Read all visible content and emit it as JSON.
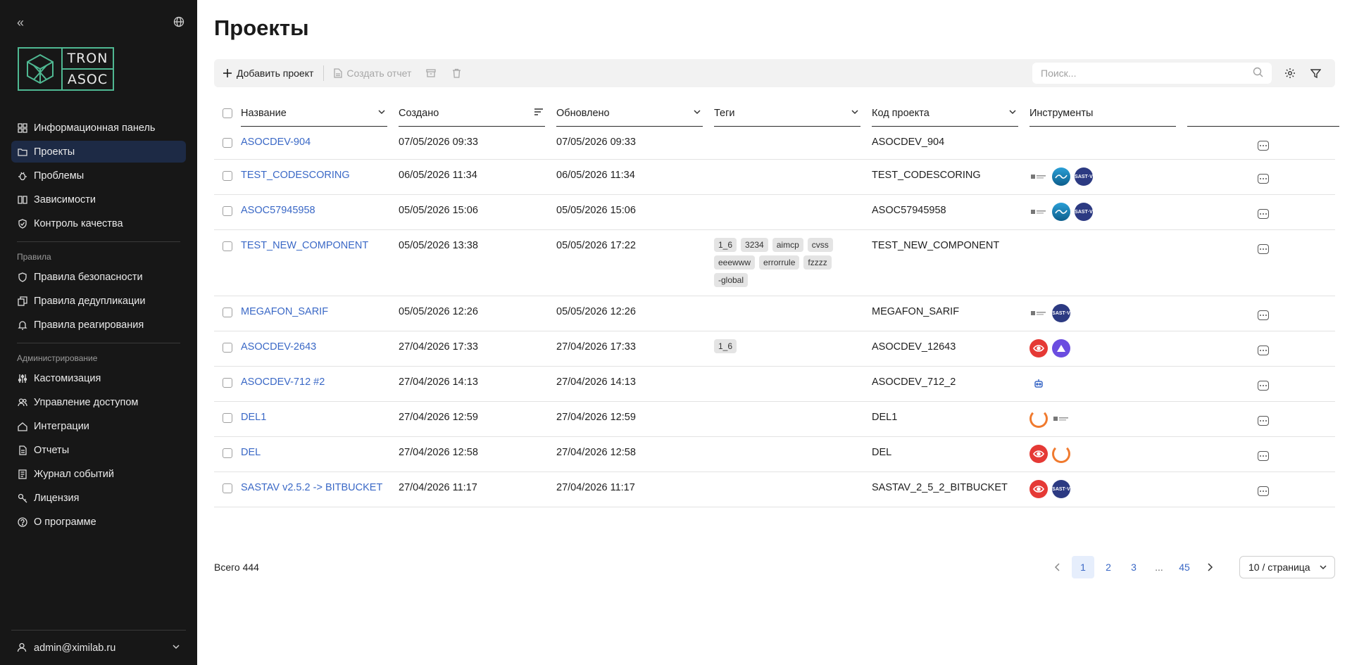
{
  "sidebar": {
    "logo": {
      "line1": "TRON",
      "line2": "ASOC"
    },
    "nav": [
      {
        "label": "Информационная панель",
        "icon": "dashboard-icon",
        "active": false
      },
      {
        "label": "Проекты",
        "icon": "folder-icon",
        "active": true
      },
      {
        "label": "Проблемы",
        "icon": "bug-icon",
        "active": false
      },
      {
        "label": "Зависимости",
        "icon": "book-icon",
        "active": false
      },
      {
        "label": "Контроль качества",
        "icon": "shield-check-icon",
        "active": false
      }
    ],
    "section_rules": "Правила",
    "rules": [
      {
        "label": "Правила безопасности",
        "icon": "shield-icon"
      },
      {
        "label": "Правила дедупликации",
        "icon": "copy-icon"
      },
      {
        "label": "Правила реагирования",
        "icon": "bell-icon"
      }
    ],
    "section_admin": "Администрирование",
    "admin": [
      {
        "label": "Кастомизация",
        "icon": "sliders-icon"
      },
      {
        "label": "Управление доступом",
        "icon": "users-icon"
      },
      {
        "label": "Интеграции",
        "icon": "cloud-icon"
      },
      {
        "label": "Отчеты",
        "icon": "file-icon"
      },
      {
        "label": "Журнал событий",
        "icon": "journal-icon"
      },
      {
        "label": "Лицензия",
        "icon": "key-icon"
      },
      {
        "label": "О программе",
        "icon": "help-icon"
      }
    ],
    "user": "admin@ximilab.ru"
  },
  "page": {
    "title": "Проекты"
  },
  "toolbar": {
    "add_label": "Добавить проект",
    "report_label": "Создать отчет",
    "search_placeholder": "Поиск..."
  },
  "table": {
    "headers": {
      "name": "Название",
      "created": "Создано",
      "updated": "Обновлено",
      "tags": "Теги",
      "code": "Код проекта",
      "tools": "Инструменты"
    },
    "rows": [
      {
        "name": "ASOCDEV-904",
        "created": "07/05/2026 09:33",
        "updated": "07/05/2026 09:33",
        "tags": [],
        "code": "ASOCDEV_904",
        "tools": []
      },
      {
        "name": "TEST_CODESCORING",
        "created": "06/05/2026 11:34",
        "updated": "06/05/2026 11:34",
        "tags": [],
        "code": "TEST_CODESCORING",
        "tools": [
          "logo",
          "wave",
          "sast"
        ]
      },
      {
        "name": "ASOC57945958",
        "created": "05/05/2026 15:06",
        "updated": "05/05/2026 15:06",
        "tags": [],
        "code": "ASOC57945958",
        "tools": [
          "logo",
          "wave",
          "sast"
        ]
      },
      {
        "name": "TEST_NEW_COMPONENT",
        "created": "05/05/2026 13:38",
        "updated": "05/05/2026 17:22",
        "tags": [
          "1_6",
          "3234",
          "aimcp",
          "cvss",
          "eeewww",
          "errorrule",
          "fzzzz",
          "-global"
        ],
        "code": "TEST_NEW_COMPONENT",
        "tools": []
      },
      {
        "name": "MEGAFON_SARIF",
        "created": "05/05/2026 12:26",
        "updated": "05/05/2026 12:26",
        "tags": [],
        "code": "MEGAFON_SARIF",
        "tools": [
          "logo",
          "sast"
        ]
      },
      {
        "name": "ASOCDEV-2643",
        "created": "27/04/2026 17:33",
        "updated": "27/04/2026 17:33",
        "tags": [
          "1_6"
        ],
        "code": "ASOCDEV_12643",
        "tools": [
          "eye",
          "purple"
        ]
      },
      {
        "name": "ASOCDEV-712 #2",
        "created": "27/04/2026 14:13",
        "updated": "27/04/2026 14:13",
        "tags": [],
        "code": "ASOCDEV_712_2",
        "tools": [
          "robot"
        ]
      },
      {
        "name": "DEL1",
        "created": "27/04/2026 12:59",
        "updated": "27/04/2026 12:59",
        "tags": [],
        "code": "DEL1",
        "tools": [
          "ring",
          "logo"
        ]
      },
      {
        "name": "DEL",
        "created": "27/04/2026 12:58",
        "updated": "27/04/2026 12:58",
        "tags": [],
        "code": "DEL",
        "tools": [
          "eye",
          "ring"
        ]
      },
      {
        "name": "SASTAV v2.5.2 -> BITBUCKET",
        "created": "27/04/2026 11:17",
        "updated": "27/04/2026 11:17",
        "tags": [],
        "code": "SASTAV_2_5_2_BITBUCKET",
        "tools": [
          "eye",
          "sast"
        ]
      }
    ]
  },
  "footer": {
    "total": "Всего 444",
    "pages": [
      "1",
      "2",
      "3",
      "...",
      "45"
    ],
    "current_page": "1",
    "page_size": "10 / страница"
  },
  "colors": {
    "accent": "#3a68c6",
    "sidebar_bg": "#171717",
    "active_bg": "#1d2a45",
    "logo": "#4fb892"
  }
}
